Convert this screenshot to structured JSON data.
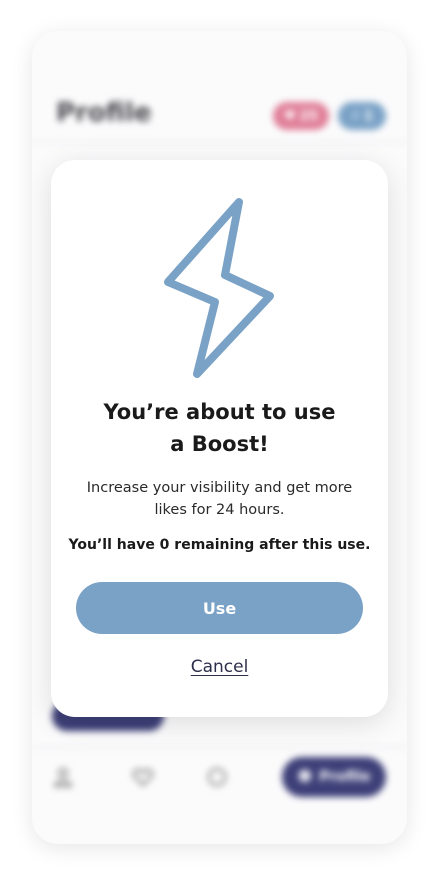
{
  "background_app": {
    "page_title": "Profile",
    "likes_badge": "25",
    "boosts_badge": "1",
    "nav": {
      "profile_label": "Profile",
      "icons": [
        "home-icon",
        "heart-icon",
        "chat-icon",
        "user-icon"
      ]
    }
  },
  "modal": {
    "icon": "lightning-bolt-icon",
    "title": "You’re about to use\na Boost!",
    "description": "Increase your visibility and get more\nlikes for 24 hours.",
    "note": "You’ll have 0 remaining after this use.",
    "use_label": "Use",
    "cancel_label": "Cancel"
  },
  "colors": {
    "accent": "#7aa2c6",
    "nav_dark": "#3d3f78",
    "like_pink": "#e07f98"
  }
}
